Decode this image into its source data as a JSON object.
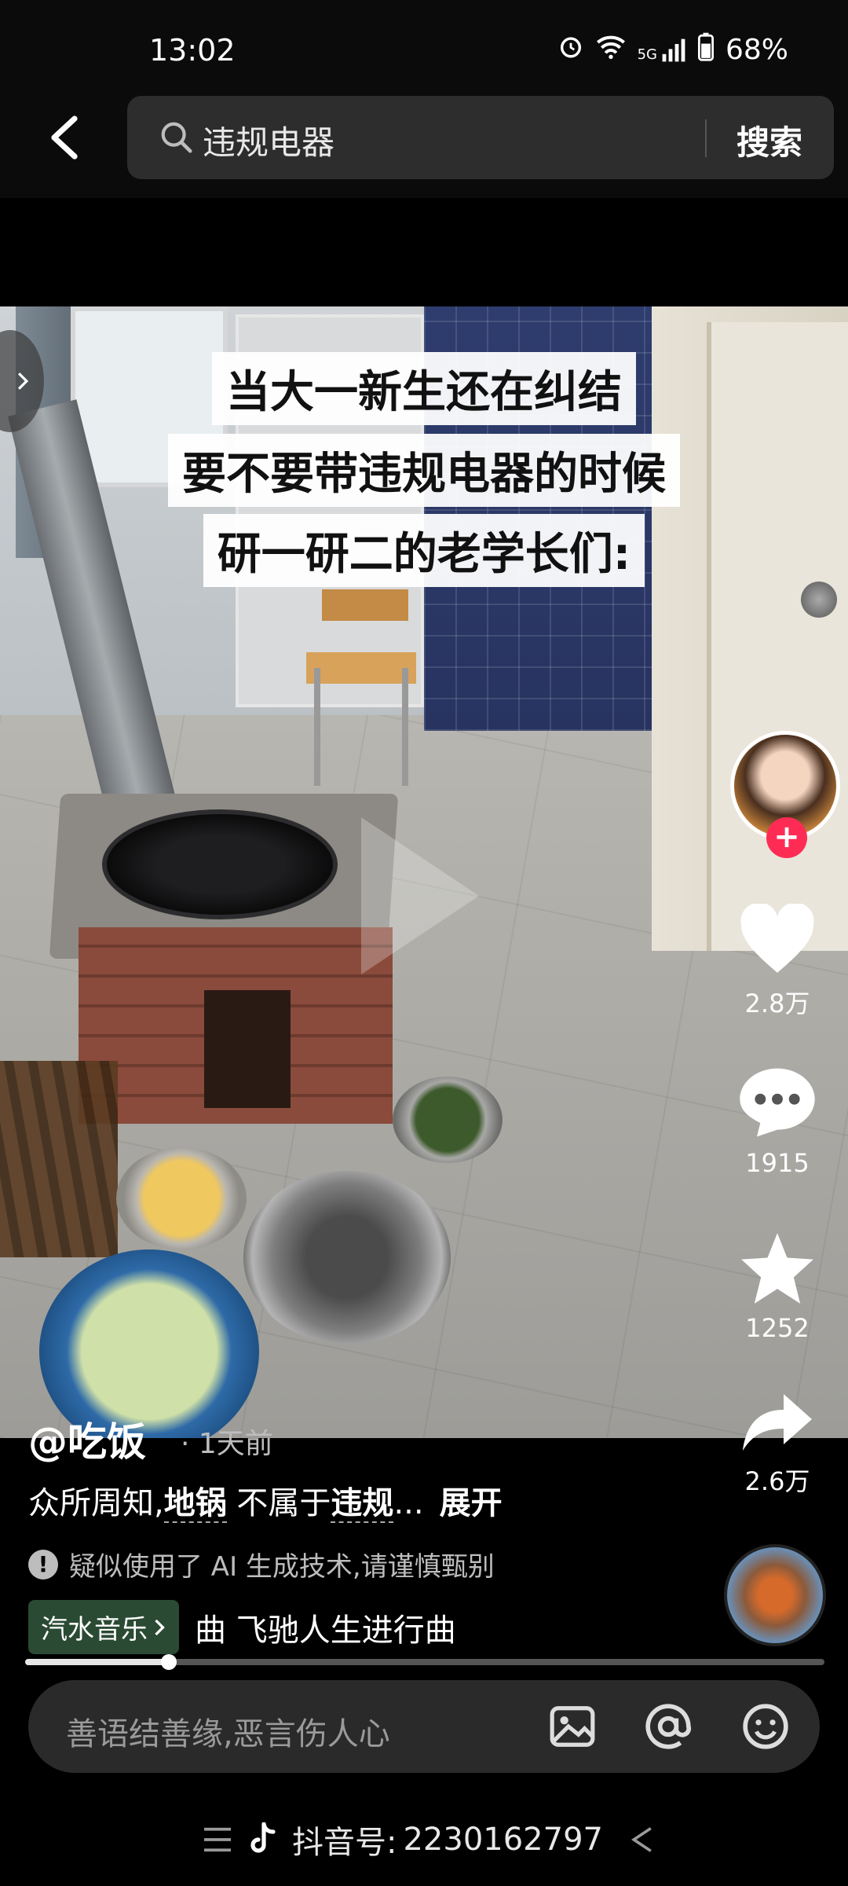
{
  "status_bar": {
    "time": "13:02",
    "network": "5G",
    "battery": "68%"
  },
  "search": {
    "query": "违规电器",
    "button_label": "搜索"
  },
  "video": {
    "caption_lines": [
      "当大一新生还在纠结",
      "要不要带违规电器的时候",
      "研一研二的老学长们:"
    ]
  },
  "actions": {
    "likes": "2.8万",
    "comments": "1915",
    "favorites": "1252",
    "shares": "2.6万"
  },
  "post": {
    "author": "@吃饭",
    "posted_time": "· 1天前",
    "desc_prefix": "众所周知,",
    "desc_tag1": "地锅",
    "desc_mid": " 不属于",
    "desc_tag2": "违规",
    "desc_ellipsis": "...",
    "expand_label": "展开",
    "ai_notice": "疑似使用了 AI 生成技术,请谨慎甄别",
    "music_tag": "汽水音乐",
    "music_title": "曲  飞驰人生进行曲"
  },
  "progress": {
    "fraction": 0.18
  },
  "comment": {
    "placeholder": "善语结善缘,恶言伤人心"
  },
  "navbar": {
    "label": "抖音号: ",
    "id": "2230162797"
  },
  "colors": {
    "accent": "#fe2c55",
    "music_tag_bg": "#2b4a33"
  }
}
